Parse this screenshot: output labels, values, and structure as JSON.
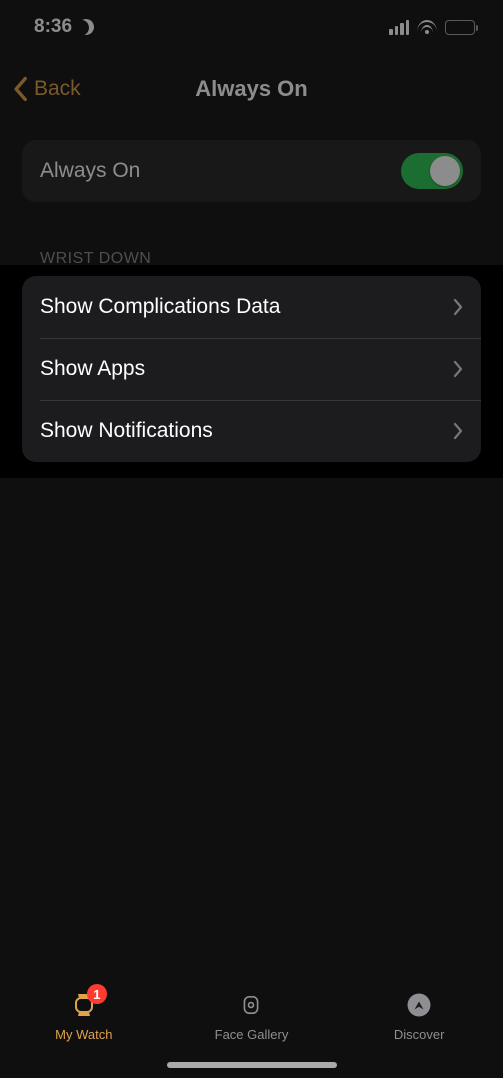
{
  "status": {
    "time": "8:36"
  },
  "nav": {
    "back": "Back",
    "title": "Always On"
  },
  "always_on": {
    "label": "Always On",
    "on": true
  },
  "section_header": "WRIST DOWN",
  "wrist_down": {
    "items": [
      {
        "label": "Show Complications Data"
      },
      {
        "label": "Show Apps"
      },
      {
        "label": "Show Notifications"
      }
    ]
  },
  "tabs": {
    "my_watch": {
      "label": "My Watch",
      "badge": "1"
    },
    "face_gallery": {
      "label": "Face Gallery"
    },
    "discover": {
      "label": "Discover"
    }
  }
}
